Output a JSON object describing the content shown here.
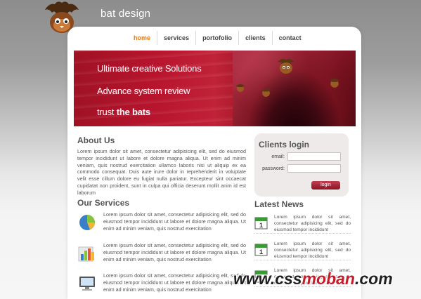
{
  "brand": {
    "name": "bat design"
  },
  "nav": {
    "items": [
      "home",
      "services",
      "portofolio",
      "clients",
      "contact"
    ],
    "active": "home"
  },
  "banner": {
    "line1": "Ultimate creative Solutions",
    "line2": "Advance system review",
    "line3_prefix": "trust ",
    "line3_bold": "the bats"
  },
  "about": {
    "title": "About Us",
    "text": "Lorem ipsum dolor sit amet, consectetur adipisicing elit, sed do eiusmod tempor incididunt ut labore et dolore magna aliqua. Ut enim ad minim veniam, quis nostrud exercitation ullamco laboris nisi ut aliquip ex ea commodo consequat. Duis aute irure dolor in reprehenderit in voluptate velit esse cillum dolore eu fugiat nulla pariatur. Excepteur sint occaecat cupidatat non proident, sunt in culpa qui officia deserunt mollit anim id est laborum"
  },
  "login": {
    "title": "Clients login",
    "email_label": "email:",
    "password_label": "password:",
    "email_value": "",
    "password_value": "",
    "button_label": "login"
  },
  "services": {
    "title": "Our Services",
    "items": [
      {
        "icon": "pie-chart-icon",
        "text": "Lorem ipsum dolor sit amet, consectetur adipisicing elit, sed do eiusmod tempor incididunt ut labore et dolore magna aliqua. Ut enim ad minim veniam, quis nostrud exercitation"
      },
      {
        "icon": "bar-chart-icon",
        "text": "Lorem ipsum dolor sit amet, consectetur adipisicing elit, sed do eiusmod tempor incididunt ut labore et dolore magna aliqua. Ut enim ad minim veniam, quis nostrud exercitation"
      },
      {
        "icon": "monitor-icon",
        "text": "Lorem ipsum dolor sit amet, consectetur adipisicing elit, sed do eiusmod tempor incididunt ut labore et dolore magna aliqua. Ut enim ad minim veniam, quis nostrud exercitation"
      }
    ]
  },
  "news": {
    "title": "Latest News",
    "items": [
      {
        "icon": "calendar-icon",
        "day": "1",
        "text": "Lorem ipsum dolor sit amet, consectetur adipisicing elit, sed do eiusmod tempor incididunt"
      },
      {
        "icon": "calendar-icon",
        "day": "1",
        "text": "Lorem ipsum dolor sit amet, consectetur adipisicing elit, sed do eiusmod tempor incididunt"
      },
      {
        "icon": "calendar-icon",
        "day": "1",
        "text": "Lorem ipsum dolor sit amet, consectetur adipisicing elit, sed do eiusmod tempor incididunt"
      }
    ]
  },
  "watermark": {
    "part1": "www.css",
    "part2": "moban",
    "part3": ".com"
  },
  "colors": {
    "accent": "#e07a1e",
    "banner_red": "#b8152e",
    "button": "#a4202f",
    "text": "#555555"
  }
}
